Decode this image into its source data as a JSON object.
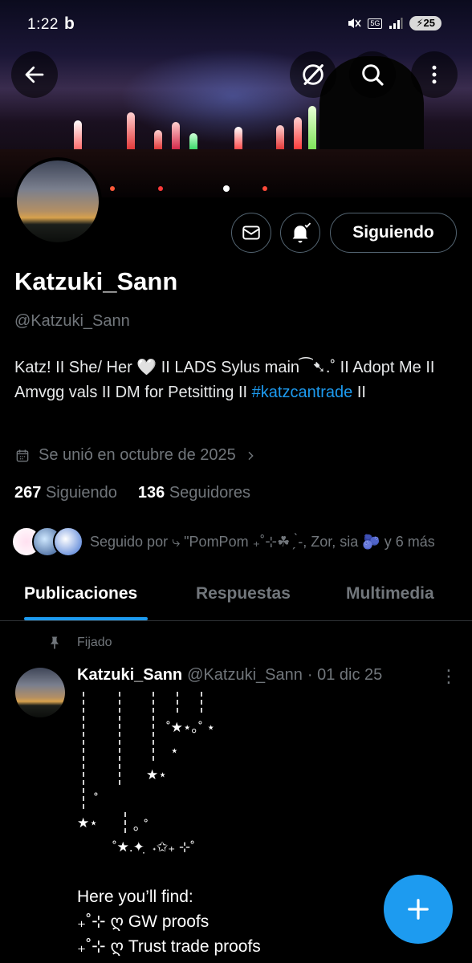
{
  "status_bar": {
    "time": "1:22",
    "app_indicator": "b",
    "network": "5G",
    "battery": "25"
  },
  "header": {
    "back_icon": "arrow-left-icon",
    "grok_icon": "slash-circle-icon",
    "search_icon": "search-icon",
    "more_icon": "vertical-dots-icon"
  },
  "profile": {
    "display_name": "Katzuki_Sann",
    "handle": "@Katzuki_Sann",
    "bio_text": "Katz! II  She/ Her 🤍 II LADS Sylus main⁀➷.˚ II  Adopt Me II Amvgg vals II DM for Petsitting II ",
    "bio_hashtag": "#katzcantrade",
    "bio_end": " II",
    "joined": "Se unió en octubre de 2025",
    "following_count": "267",
    "following_label": "Siguiendo",
    "followers_count": "136",
    "followers_label": "Seguidores",
    "followed_by": "Seguido por ⤷ \"PomPom ₊˚⊹☘ ̗ ̀-, Zor, sia 🫐 y 6 más",
    "follow_button": "Siguiendo"
  },
  "tabs": [
    {
      "label": "Publicaciones",
      "active": true
    },
    {
      "label": "Respuestas",
      "active": false
    },
    {
      "label": "Multimedia",
      "active": false
    }
  ],
  "post": {
    "pinned_label": "Fijado",
    "author_name": "Katzuki_Sann",
    "author_handle": "@Katzuki_Sann",
    "date": "· 01 dic 25",
    "deco": {
      "d1": "˚★⋆｡˚ ⋆",
      "d2": "⋆",
      "d3": "★⋆",
      "d4": "˚",
      "d5": "★⋆",
      "d6": "｡ ˚",
      "d7": "˚★.✦ ̣ ˖✩₊ ⊹˚"
    },
    "body_lines": [
      "Here you’ll find:",
      "₊˚⊹ ღ GW proofs",
      "₊˚⊹ ღ Trust trade proofs"
    ]
  },
  "colors": {
    "accent": "#1d9bf0",
    "muted": "#71767b",
    "background": "#000000"
  }
}
